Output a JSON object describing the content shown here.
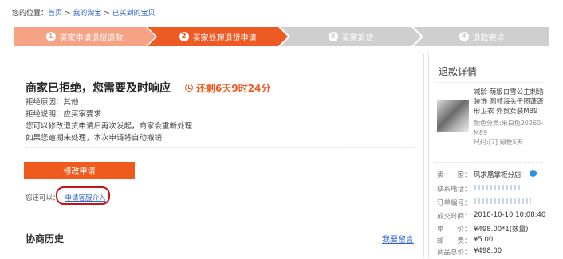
{
  "breadcrumb": {
    "prefix": "您的位置：",
    "home": "首页",
    "sep1": " > ",
    "my_taobao": "我的淘宝",
    "sep2": " > ",
    "bought": "已买到的宝贝"
  },
  "steps": [
    {
      "num": "1",
      "label": "买家申请退货退款"
    },
    {
      "num": "2",
      "label": "买家处理退货申请"
    },
    {
      "num": "3",
      "label": "买家退货"
    },
    {
      "num": "4",
      "label": "退款完毕"
    }
  ],
  "status": {
    "title": "商家已拒绝，您需要及时响应",
    "countdown": "还剩6天9时24分"
  },
  "info": {
    "reason": "拒绝原因：其他",
    "explain": "拒绝说明：应买家要求",
    "line3": "您可以修改退货申请后再次发起，商家会重新处理",
    "line4": "如果您逾期未处理，本次申请将自动撤销"
  },
  "actions": {
    "modify": "修改申请",
    "also_prefix": "您还可以：",
    "apply_intervention": "申请客服介入"
  },
  "history": {
    "title": "协商历史",
    "leave_message": "我要留言"
  },
  "sidebar": {
    "title": "退款详情",
    "product_name": "减龄 萌版白雪公主刺绣装饰 圆领海头千图蓬蓬形卫衣 外贸女装M89",
    "product_color": "颜色分类:米白色20260-M89",
    "product_size": "尺码:[7]  绿框5天",
    "seller_label": "卖　　家：",
    "seller_value": "凤求凰掌柜分店",
    "phone_label": "联系电话：",
    "phone_value": "",
    "order_label": "订单编号：",
    "order_value": "",
    "time_label": "成交时间：",
    "time_value": "2018-10-10 10:08:40",
    "price_label": "单　　价：",
    "price_value": "¥498.00*1(数量)",
    "postage_label": "邮　　费：",
    "postage_value": "¥5.00",
    "total_label": "商品总价：",
    "total_value": "¥498.00"
  },
  "colors": {
    "accent": "#ee5a24",
    "step_done": "#f6a284",
    "step_todo": "#cfcfcf",
    "link": "#3366cc",
    "highlight_ring": "#c3141c"
  }
}
